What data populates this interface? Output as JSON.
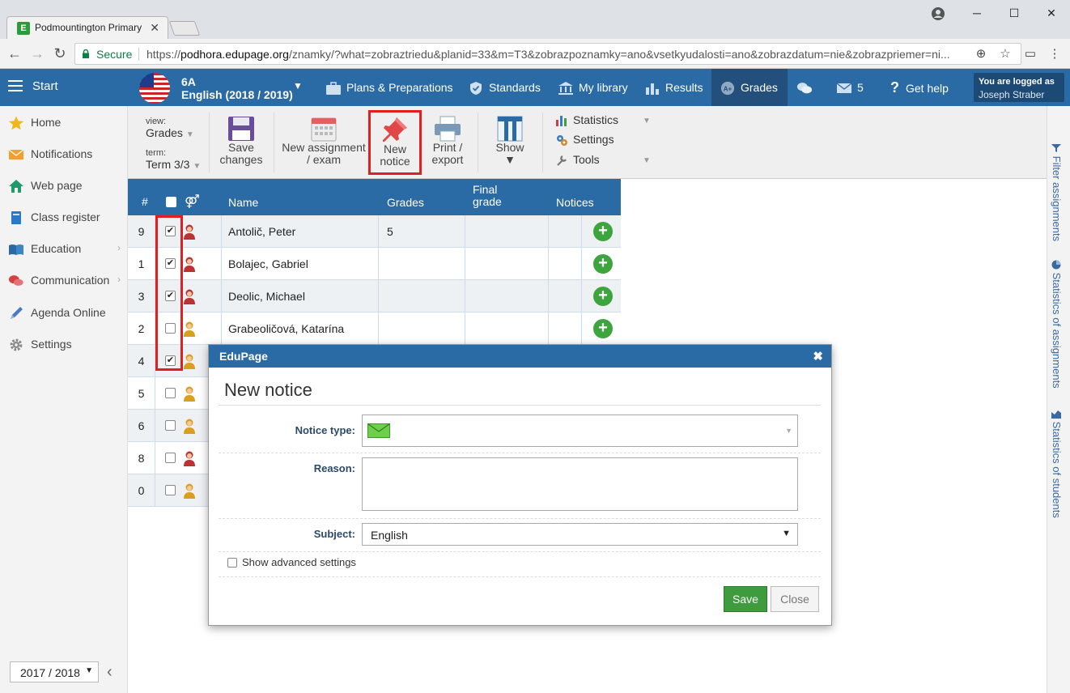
{
  "browser": {
    "tab_title": "Podmountington Primary",
    "tab_favicon": "E",
    "secure_label": "Secure",
    "url_prefix": "https://",
    "url_domain": "podhora.edupage.org",
    "url_path": "/znamky/?what=zobraztriedu&planid=33&m=T3&zobrazpoznamky=ano&vsetkyudalosti=ano&zobrazdatum=nie&zobrazpriemer=ni..."
  },
  "header": {
    "start_label": "Start",
    "class_code": "6A",
    "course": "English (2018 / 2019)",
    "menu": [
      {
        "label": "Plans & Preparations",
        "icon": "briefcase-icon"
      },
      {
        "label": "Standards",
        "icon": "shield-check-icon"
      },
      {
        "label": "My library",
        "icon": "library-icon"
      },
      {
        "label": "Results",
        "icon": "bar-chart-icon"
      },
      {
        "label": "Grades",
        "icon": "grades-icon"
      }
    ],
    "messages_count": "5",
    "help_label": "Get help",
    "logged_in_label": "You are logged as",
    "user_name": "Joseph Straber"
  },
  "sidebar": {
    "items": [
      {
        "label": "Home",
        "icon": "star-icon"
      },
      {
        "label": "Notifications",
        "icon": "envelope-icon"
      },
      {
        "label": "Web page",
        "icon": "house-icon"
      },
      {
        "label": "Class register",
        "icon": "register-book-icon"
      },
      {
        "label": "Education",
        "icon": "open-book-icon"
      },
      {
        "label": "Communication",
        "icon": "speech-bubbles-icon"
      },
      {
        "label": "Agenda Online",
        "icon": "pen-icon"
      },
      {
        "label": "Settings",
        "icon": "gear-icon"
      }
    ],
    "school_year": "2017 / 2018"
  },
  "toolbar": {
    "view_label": "view:",
    "view_value": "Grades",
    "term_label": "term:",
    "term_value": "Term 3/3",
    "save_line1": "Save",
    "save_line2": "changes",
    "new_assignment_line1": "New assignment",
    "new_assignment_line2": "/ exam",
    "new_notice_line1": "New",
    "new_notice_line2": "notice",
    "print_line1": "Print /",
    "print_line2": "export",
    "show_label": "Show",
    "statistics_label": "Statistics",
    "settings_label": "Settings",
    "tools_label": "Tools"
  },
  "right_rail": {
    "filter_label": "Filter assignments",
    "stats_assignments_label": "Statistics of assignments",
    "stats_students_label": "Statistics of students"
  },
  "grid": {
    "headers": {
      "number": "#",
      "name": "Name",
      "grades": "Grades",
      "final_grade_line1": "Final",
      "final_grade_line2": "grade",
      "notices": "Notices"
    },
    "rows": [
      {
        "number": "9",
        "name": "Antolič, Peter",
        "grade": "5",
        "checked": true,
        "gender": "male"
      },
      {
        "number": "1",
        "name": "Bolajec, Gabriel",
        "grade": "",
        "checked": true,
        "gender": "male"
      },
      {
        "number": "3",
        "name": "Deolic, Michael",
        "grade": "",
        "checked": true,
        "gender": "male"
      },
      {
        "number": "2",
        "name": "Grabeoličová, Katarína",
        "grade": "",
        "checked": false,
        "gender": "female"
      },
      {
        "number": "4",
        "name": "",
        "grade": "",
        "checked": true,
        "gender": "female"
      },
      {
        "number": "5",
        "name": "",
        "grade": "",
        "checked": false,
        "gender": "female"
      },
      {
        "number": "6",
        "name": "",
        "grade": "",
        "checked": false,
        "gender": "female"
      },
      {
        "number": "8",
        "name": "",
        "grade": "",
        "checked": false,
        "gender": "male"
      },
      {
        "number": "0",
        "name": "",
        "grade": "",
        "checked": false,
        "gender": "female"
      }
    ]
  },
  "dialog": {
    "window_title": "EduPage",
    "heading": "New notice",
    "notice_type_label": "Notice type:",
    "reason_label": "Reason:",
    "subject_label": "Subject:",
    "subject_value": "English",
    "advanced_label": "Show advanced settings",
    "save_label": "Save",
    "close_label": "Close"
  },
  "colors": {
    "accent_blue": "#2a6aa5",
    "highlight_red": "#e02020",
    "save_green": "#3e9b3e"
  }
}
